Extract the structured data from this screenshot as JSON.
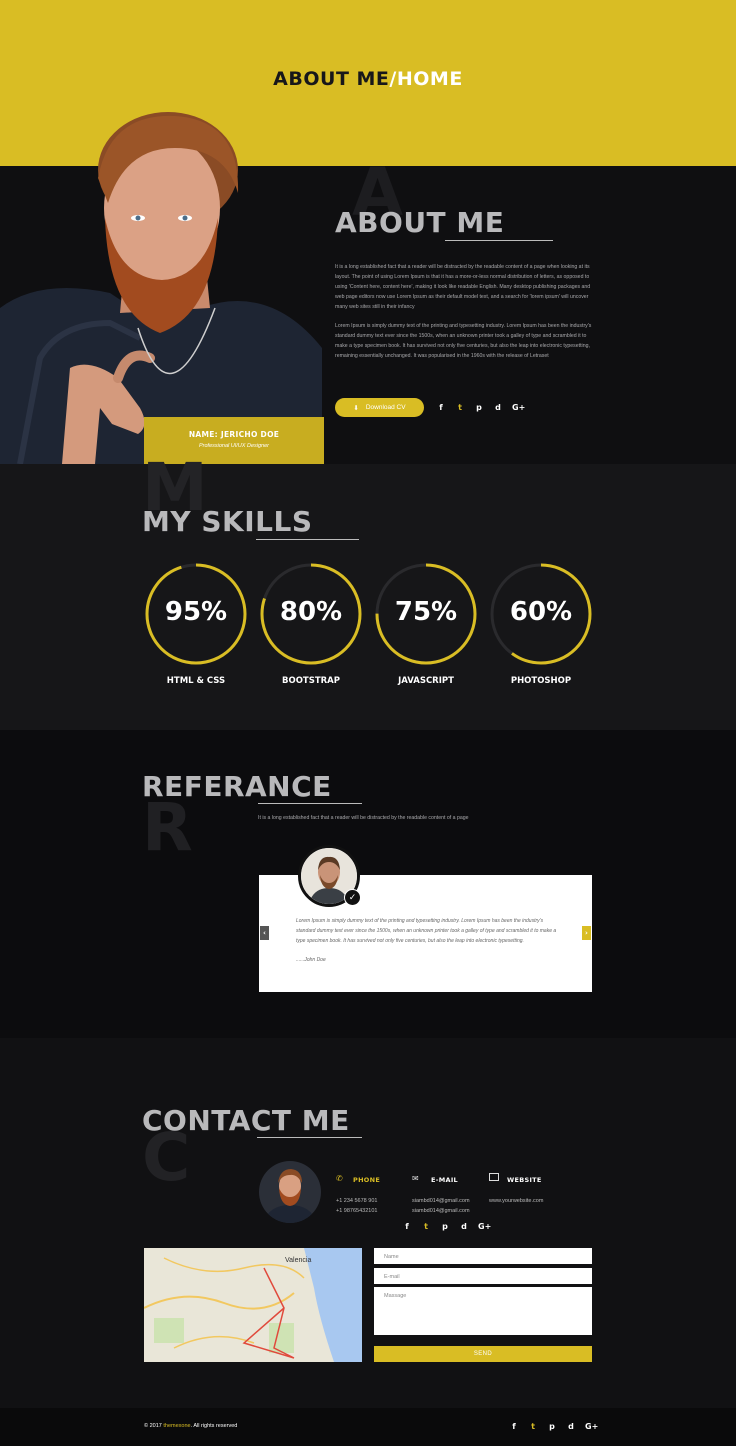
{
  "header": {
    "title_part1": "ABOUT ME",
    "separator": "/",
    "title_part2": "HOME"
  },
  "about": {
    "big_letter": "A",
    "title": "ABOUT ME",
    "paragraph1": "It is a long established fact that a reader will be distracted by the readable content of a page when looking at its layout. The point of using Lorem Ipsum is that it has a more-or-less normal distribution of letters, as opposed to using 'Content here, content here', making it look like readable English. Many desktop publishing packages and web page editors now use Lorem Ipsum as their default model text, and a search for 'lorem ipsum' will uncover many web sites still in their infancy",
    "paragraph2": "Lorem Ipsum is simply dummy text of the printing and typesetting industry. Lorem Ipsum has been the industry's standard dummy text ever since the 1500s, when an unknown printer took a galley of type and scrambled it to make a type specimen book. It has survived not only five centuries, but also the leap into electronic typesetting, remaining essentially unchanged. It was popularised in the 1960s with the release of Letraset",
    "name": "NAME: JERICHO DOE",
    "role": "Professional UI/UX Designer",
    "download_label": "Download CV",
    "social": [
      "f",
      "t",
      "p",
      "d",
      "G+"
    ]
  },
  "skills": {
    "big_letter": "M",
    "title": "MY SKILLS",
    "items": [
      {
        "value": "95%",
        "label": "HTML & CSS",
        "percent": 95
      },
      {
        "value": "80%",
        "label": "BOOTSTRAP",
        "percent": 80
      },
      {
        "value": "75%",
        "label": "JAVASCRIPT",
        "percent": 75
      },
      {
        "value": "60%",
        "label": "PHOTOSHOP",
        "percent": 60
      }
    ]
  },
  "reference": {
    "big_letter": "R",
    "title": "REFERANCE",
    "subtitle": "It is a long established fact that a reader will be distracted by the readable content of a page",
    "quote": "Lorem Ipsum is simply dummy text of the printing and typesetting industry. Lorem Ipsum has been the industry's standard dummy text ever since the 1500s, when an unknown printer took a galley of type and scrambled it to make a type specimen book. It has survived not only five centuries, but also the leap into electronic typesetting.",
    "author": "......John Doe",
    "prev": "‹",
    "next": "›"
  },
  "contact": {
    "big_letter": "C",
    "title": "CONTACT ME",
    "phone_label": "PHONE",
    "phone_1": "+1 234 5678 901",
    "phone_2": "+1 98765432101",
    "email_label": "E-MAIL",
    "email_1": "siambd014@gmail.com",
    "email_2": "siambd014@gmail.com",
    "website_label": "WEBSITE",
    "website": "www.yourwebsite.com",
    "social": [
      "f",
      "t",
      "p",
      "d",
      "G+"
    ],
    "name_placeholder": "Name",
    "email_placeholder": "E-mail",
    "message_placeholder": "Massage",
    "send_label": "SEND",
    "map_label": "Valencia"
  },
  "footer": {
    "copyright_prefix": "© 2017 ",
    "brand": "themexone",
    "copyright_suffix": ". All rights reserved",
    "social": [
      "f",
      "t",
      "p",
      "d",
      "G+"
    ]
  },
  "colors": {
    "accent": "#d9bd24",
    "dark": "#0f0f11"
  }
}
